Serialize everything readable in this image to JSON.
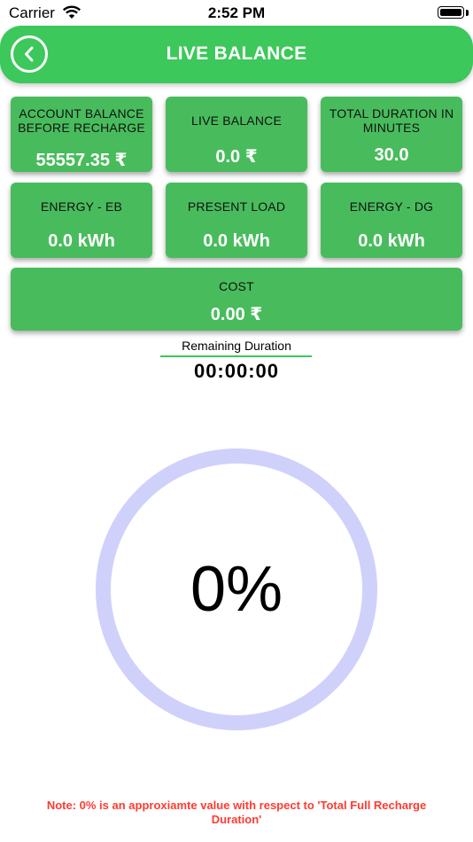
{
  "status_bar": {
    "carrier": "Carrier",
    "time": "2:52 PM"
  },
  "header": {
    "title": "LIVE BALANCE",
    "back_icon": "chevron-left-circle-icon"
  },
  "cards": {
    "account_balance": {
      "label": "ACCOUNT BALANCE BEFORE RECHARGE",
      "value": "55557.35 ₹"
    },
    "live_balance": {
      "label": "LIVE BALANCE",
      "value": "0.0 ₹"
    },
    "total_duration": {
      "label": "TOTAL DURATION IN MINUTES",
      "value": "30.0"
    },
    "energy_eb": {
      "label": "ENERGY - EB",
      "value": "0.0 kWh"
    },
    "present_load": {
      "label": "PRESENT LOAD",
      "value": "0.0 kWh"
    },
    "energy_dg": {
      "label": "ENERGY - DG",
      "value": "0.0 kWh"
    },
    "cost": {
      "label": "COST",
      "value": "0.00 ₹"
    }
  },
  "remaining": {
    "label": "Remaining Duration",
    "time": "00:00:00"
  },
  "progress": {
    "text": "0%",
    "fraction": 0.0,
    "ring_color": "#cfd1fb"
  },
  "note": "Note: 0% is an approxiamte value with respect to 'Total Full Recharge Duration'",
  "colors": {
    "accent": "#3cc85a",
    "card": "#48bc5c",
    "note": "#ff3b30"
  }
}
